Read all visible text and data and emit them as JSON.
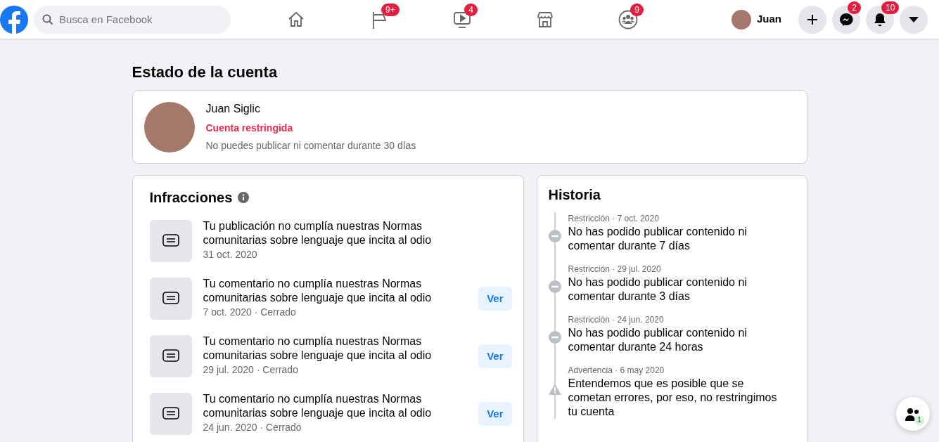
{
  "topbar": {
    "search": {
      "placeholder": "Busca en Facebook"
    },
    "nav": [
      {
        "kind": "home"
      },
      {
        "kind": "flag",
        "badge": "9+"
      },
      {
        "kind": "video",
        "badge": "4"
      },
      {
        "kind": "store"
      },
      {
        "kind": "groups",
        "badge": "9"
      }
    ],
    "profile_name": "Juan",
    "actions": [
      {
        "kind": "plus"
      },
      {
        "kind": "messenger",
        "badge": "2"
      },
      {
        "kind": "bell",
        "badge": "10"
      },
      {
        "kind": "caret"
      }
    ]
  },
  "page_title": "Estado de la cuenta",
  "account": {
    "name": "Juan Siglic",
    "status": "Cuenta restringida",
    "note": "No puedes publicar ni comentar durante 30 días"
  },
  "infractions": {
    "title": "Infracciones",
    "items": [
      {
        "text": "Tu publicación no cumplía nuestras Normas comunitarias sobre lenguaje que incita al odio",
        "meta": "31 oct. 2020"
      },
      {
        "text": "Tu comentario no cumplía nuestras Normas comunitarias sobre lenguaje que incita al odio",
        "meta": "7 oct. 2020 · Cerrado",
        "button": "Ver"
      },
      {
        "text": "Tu comentario no cumplía nuestras Normas comunitarias sobre lenguaje que incita al odio",
        "meta": "29 jul. 2020 · Cerrado",
        "button": "Ver"
      },
      {
        "text": "Tu comentario no cumplía nuestras Normas comunitarias sobre lenguaje que incita al odio",
        "meta": "24 jun. 2020 · Cerrado",
        "button": "Ver"
      }
    ]
  },
  "history": {
    "title": "Historia",
    "events": [
      {
        "kind": "restriction",
        "meta": "Restricción · 7 oct. 2020",
        "text": "No has podido publicar contenido ni comentar durante 7 días"
      },
      {
        "kind": "restriction",
        "meta": "Restricción · 29 jul. 2020",
        "text": "No has podido publicar contenido ni comentar durante 3 días"
      },
      {
        "kind": "restriction",
        "meta": "Restricción · 24 jun. 2020",
        "text": "No has podido publicar contenido ni comentar durante 24 horas"
      },
      {
        "kind": "warning",
        "meta": "Advertencia · 6 may 2020",
        "text": "Entendemos que es posible que se cometan errores, por eso, no restringimos tu cuenta"
      }
    ]
  },
  "contacts_button": {
    "badge": "1"
  }
}
